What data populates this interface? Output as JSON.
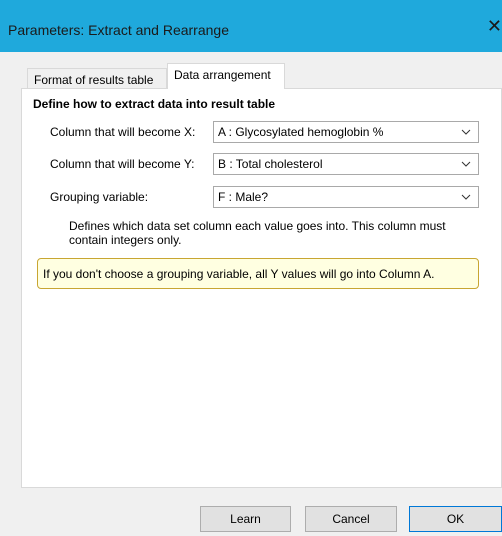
{
  "window": {
    "title": "Parameters: Extract and Rearrange",
    "close_glyph": "✕"
  },
  "tabs": [
    {
      "label": "Format of results table",
      "active": false
    },
    {
      "label": "Data arrangement",
      "active": true
    }
  ],
  "section": {
    "heading": "Define how to extract data into result table"
  },
  "fields": {
    "x_column": {
      "label": "Column that will become X:",
      "value": "A : Glycosylated hemoglobin %"
    },
    "y_column": {
      "label": "Column that will become Y:",
      "value": "B : Total cholesterol"
    },
    "grouping": {
      "label": "Grouping variable:",
      "value": "F : Male?"
    }
  },
  "help_text": "Defines which data set column each value goes into. This column must contain integers only.",
  "note_text": "If you don't choose a grouping variable, all Y values will go into Column A.",
  "buttons": {
    "learn": "Learn",
    "cancel": "Cancel",
    "ok": "OK"
  },
  "colors": {
    "titlebar": "#1fa9dc",
    "note_bg": "#ffffe1",
    "note_border": "#c8a632",
    "ok_border": "#0078d7"
  }
}
